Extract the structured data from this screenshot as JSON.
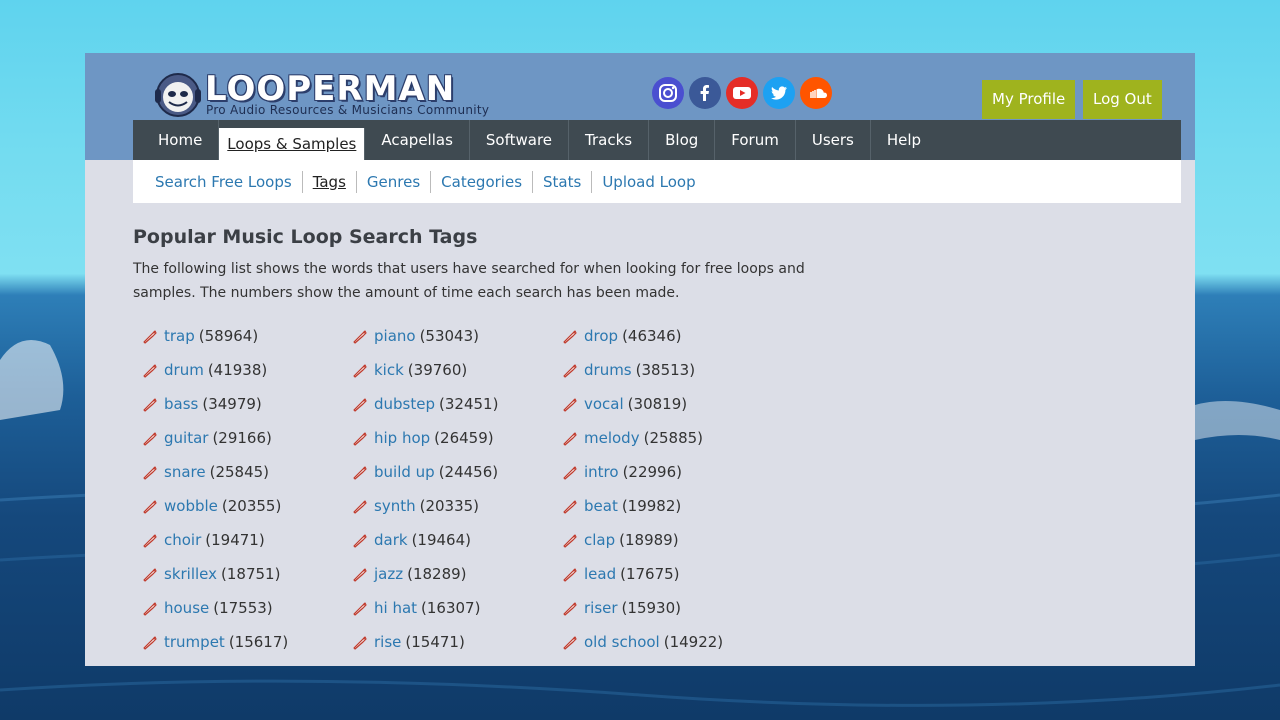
{
  "brand": {
    "title": "LOOPERMAN",
    "subtitle": "Pro Audio Resources & Musicians Community"
  },
  "social": [
    {
      "name": "instagram-icon",
      "color": "#4a4fd0"
    },
    {
      "name": "facebook-icon",
      "color": "#3b5998"
    },
    {
      "name": "youtube-icon",
      "color": "#e52d27"
    },
    {
      "name": "twitter-icon",
      "color": "#1da1f2"
    },
    {
      "name": "soundcloud-icon",
      "color": "#ff5500"
    }
  ],
  "account": {
    "profile_label": "My Profile",
    "logout_label": "Log Out"
  },
  "nav": {
    "items": [
      "Home",
      "Loops & Samples",
      "Acapellas",
      "Software",
      "Tracks",
      "Blog",
      "Forum",
      "Users",
      "Help"
    ],
    "active": "Loops & Samples"
  },
  "subnav": {
    "items": [
      "Search Free Loops",
      "Tags",
      "Genres",
      "Categories",
      "Stats",
      "Upload Loop"
    ],
    "active": "Tags"
  },
  "main": {
    "title": "Popular Music Loop Search Tags",
    "intro": "The following list shows the words that users have searched for when looking for free loops and samples. The numbers show the amount of time each search has been made."
  },
  "tags": [
    {
      "term": "trap",
      "count": "(58964)"
    },
    {
      "term": "piano",
      "count": "(53043)"
    },
    {
      "term": "drop",
      "count": "(46346)"
    },
    {
      "term": "drum",
      "count": "(41938)"
    },
    {
      "term": "kick",
      "count": "(39760)"
    },
    {
      "term": "drums",
      "count": "(38513)"
    },
    {
      "term": "bass",
      "count": "(34979)"
    },
    {
      "term": "dubstep",
      "count": "(32451)"
    },
    {
      "term": "vocal",
      "count": "(30819)"
    },
    {
      "term": "guitar",
      "count": "(29166)"
    },
    {
      "term": "hip hop",
      "count": "(26459)"
    },
    {
      "term": "melody",
      "count": "(25885)"
    },
    {
      "term": "snare",
      "count": "(25845)"
    },
    {
      "term": "build up",
      "count": "(24456)"
    },
    {
      "term": "intro",
      "count": "(22996)"
    },
    {
      "term": "wobble",
      "count": "(20355)"
    },
    {
      "term": "synth",
      "count": "(20335)"
    },
    {
      "term": "beat",
      "count": "(19982)"
    },
    {
      "term": "choir",
      "count": "(19471)"
    },
    {
      "term": "dark",
      "count": "(19464)"
    },
    {
      "term": "clap",
      "count": "(18989)"
    },
    {
      "term": "skrillex",
      "count": "(18751)"
    },
    {
      "term": "jazz",
      "count": "(18289)"
    },
    {
      "term": "lead",
      "count": "(17675)"
    },
    {
      "term": "house",
      "count": "(17553)"
    },
    {
      "term": "hi hat",
      "count": "(16307)"
    },
    {
      "term": "riser",
      "count": "(15930)"
    },
    {
      "term": "trumpet",
      "count": "(15617)"
    },
    {
      "term": "rise",
      "count": "(15471)"
    },
    {
      "term": "old school",
      "count": "(14922)"
    }
  ]
}
